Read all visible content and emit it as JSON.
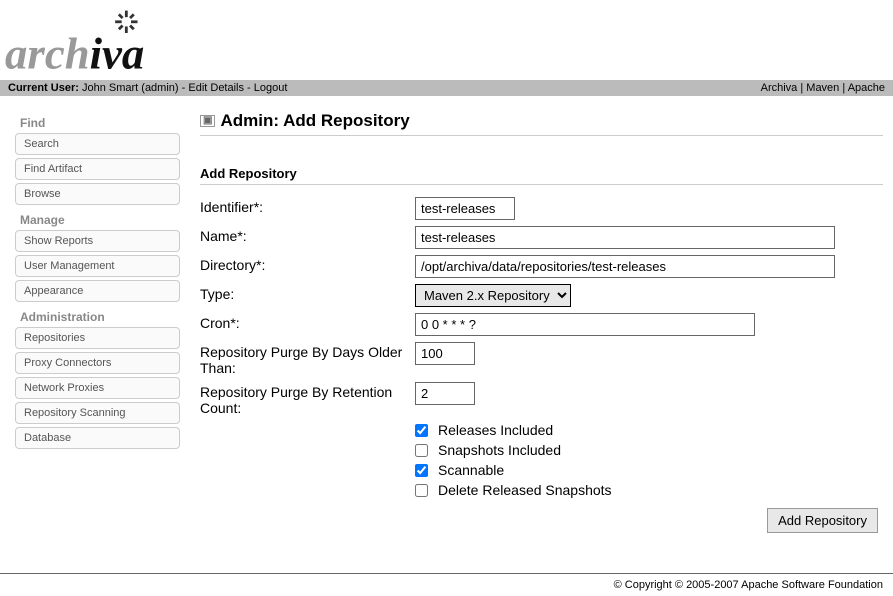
{
  "logo_text": "archiva",
  "user_bar": {
    "current_user_label": "Current User:",
    "user_name": "John Smart",
    "user_role": "(admin)",
    "edit_details": "Edit Details",
    "logout": "Logout",
    "link_archiva": "Archiva",
    "link_maven": "Maven",
    "link_apache": "Apache"
  },
  "sidebar": {
    "find": {
      "title": "Find",
      "items": [
        "Search",
        "Find Artifact",
        "Browse"
      ]
    },
    "manage": {
      "title": "Manage",
      "items": [
        "Show Reports",
        "User Management",
        "Appearance"
      ]
    },
    "administration": {
      "title": "Administration",
      "items": [
        "Repositories",
        "Proxy Connectors",
        "Network Proxies",
        "Repository Scanning",
        "Database"
      ]
    }
  },
  "page_title": "Admin: Add Repository",
  "form": {
    "section_title": "Add Repository",
    "identifier_label": "Identifier*:",
    "identifier_value": "test-releases",
    "name_label": "Name*:",
    "name_value": "test-releases",
    "directory_label": "Directory*:",
    "directory_value": "/opt/archiva/data/repositories/test-releases",
    "type_label": "Type:",
    "type_value": "Maven 2.x Repository",
    "cron_label": "Cron*:",
    "cron_value": "0 0 * * * ?",
    "purge_days_label": "Repository Purge By Days Older Than:",
    "purge_days_value": "100",
    "purge_count_label": "Repository Purge By Retention Count:",
    "purge_count_value": "2",
    "releases_label": "Releases Included",
    "snapshots_label": "Snapshots Included",
    "scannable_label": "Scannable",
    "delete_released_label": "Delete Released Snapshots",
    "submit_label": "Add Repository"
  },
  "footer": {
    "copyright": "© Copyright © 2005-2007 Apache Software Foundation"
  }
}
